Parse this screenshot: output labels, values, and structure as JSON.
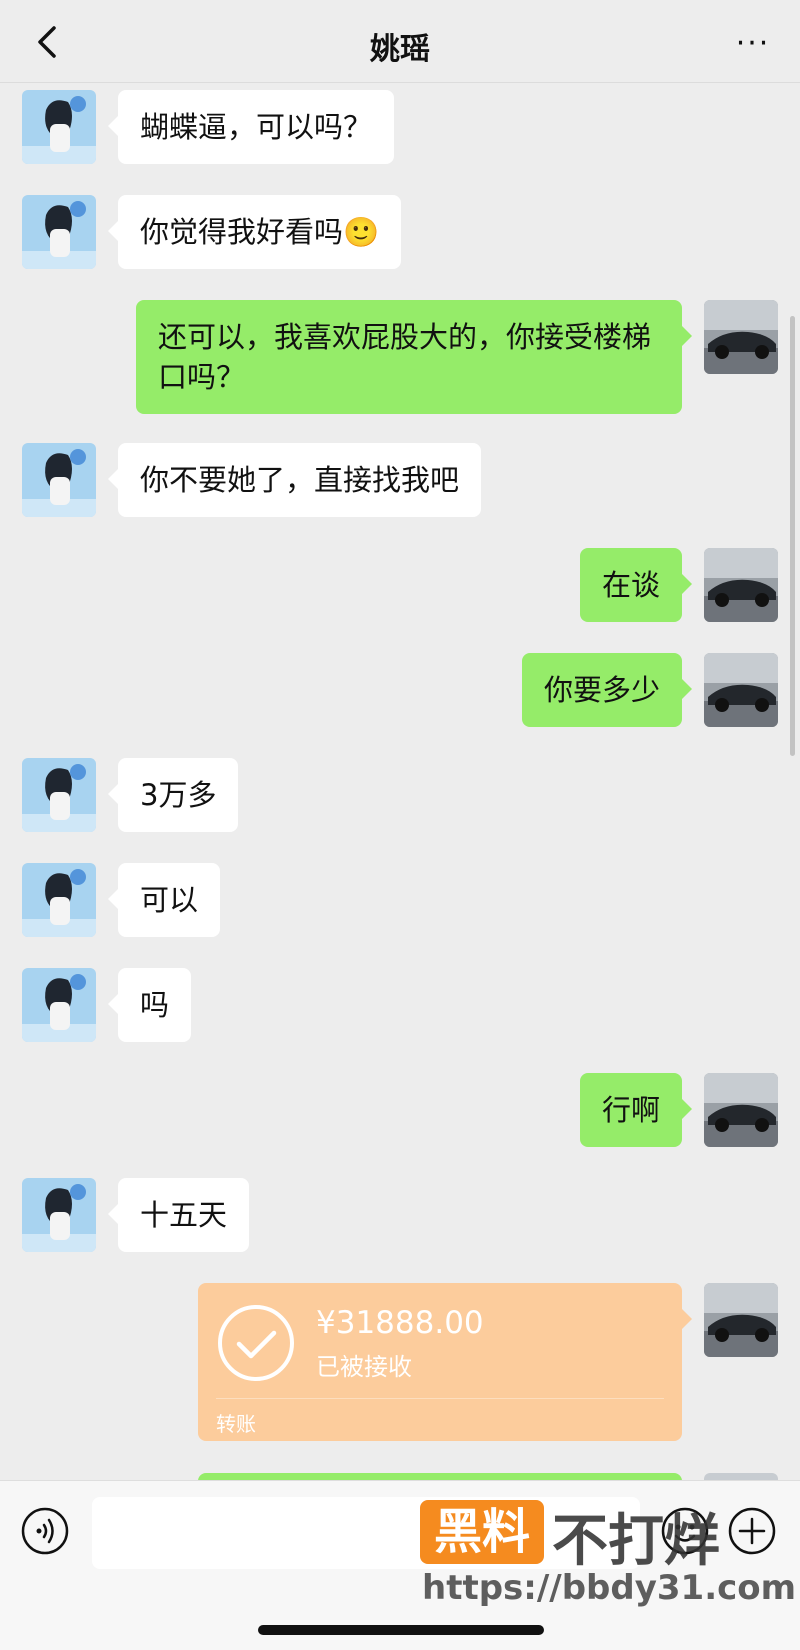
{
  "header": {
    "title": "姚瑶",
    "back_icon": "chevron-left-icon",
    "more_label": "···"
  },
  "colors": {
    "incoming_bubble": "#ffffff",
    "outgoing_bubble": "#95ec69",
    "transfer_card": "#fccc9c",
    "background": "#ededed",
    "watermark_brand": "#f58b1f"
  },
  "messages": [
    {
      "from": "contact",
      "text": "蝴蝶逼，可以吗？"
    },
    {
      "from": "contact",
      "text": "你觉得我好看吗🙂"
    },
    {
      "from": "me",
      "text": "还可以，我喜欢屁股大的，你接受楼梯口吗？"
    },
    {
      "from": "contact",
      "text": "你不要她了，直接找我吧"
    },
    {
      "from": "me",
      "text": "在谈"
    },
    {
      "from": "me",
      "text": "你要多少"
    },
    {
      "from": "contact",
      "text": "3万多"
    },
    {
      "from": "contact",
      "text": "可以"
    },
    {
      "from": "contact",
      "text": "吗"
    },
    {
      "from": "me",
      "text": "行啊"
    },
    {
      "from": "contact",
      "text": "十五天"
    }
  ],
  "transfer": {
    "amount": "¥31888.00",
    "status": "已被接收",
    "kind": "转账"
  },
  "input_bar": {
    "voice_icon": "voice-icon",
    "emoji_icon": "emoji-icon",
    "plus_icon": "plus-icon",
    "input_value": ""
  },
  "watermark": {
    "logo_text": "黑料",
    "tagline": "不打烊",
    "url": "https://bbdy31.com"
  }
}
